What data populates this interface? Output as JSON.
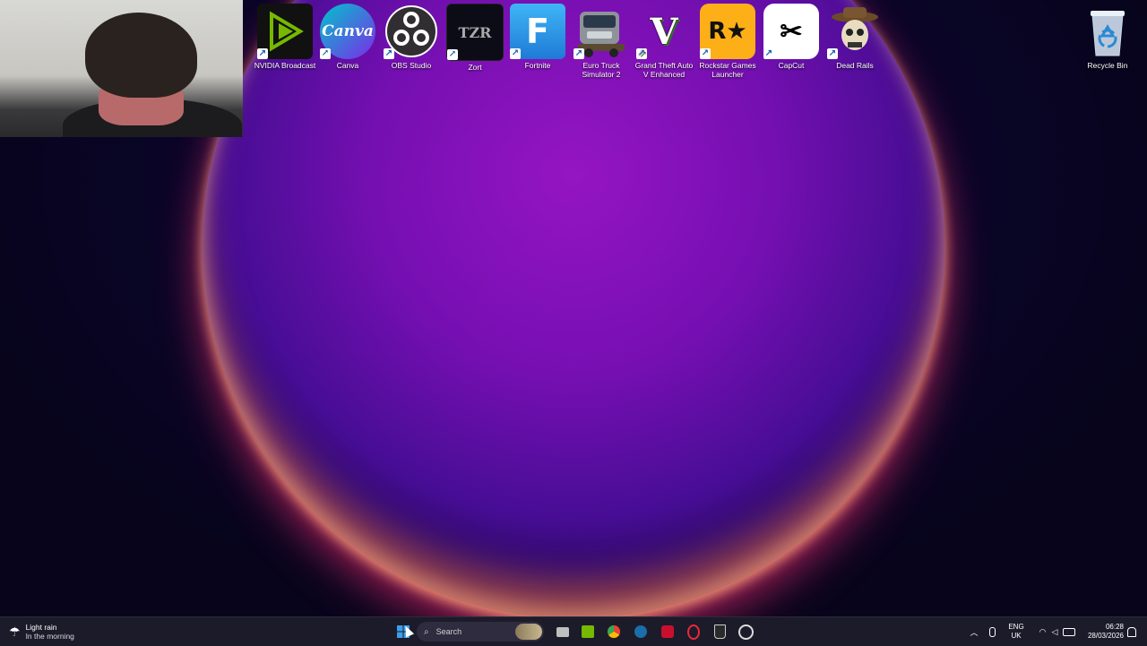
{
  "desktop": {
    "icons": [
      {
        "label": "NVIDIA Broadcast",
        "icon": "nvidia-broadcast-icon"
      },
      {
        "label": "Canva",
        "icon": "canva-icon"
      },
      {
        "label": "OBS Studio",
        "icon": "obs-icon"
      },
      {
        "label": "Zort",
        "icon": "zort-icon"
      },
      {
        "label": "Fortnite",
        "icon": "fortnite-icon"
      },
      {
        "label": "Euro Truck Simulator 2",
        "icon": "truck-icon"
      },
      {
        "label": "Grand Theft Auto V Enhanced",
        "icon": "gta-icon"
      },
      {
        "label": "Rockstar Games Launcher",
        "icon": "rockstar-icon"
      },
      {
        "label": "CapCut",
        "icon": "capcut-icon"
      },
      {
        "label": "Dead Rails",
        "icon": "dead-rails-icon"
      },
      {
        "label": "Recycle Bin",
        "icon": "recycle-bin-icon"
      }
    ],
    "icon_glyphs": {
      "canva": "Canva",
      "zort": "TZR",
      "fortnite": "F",
      "gta": "V",
      "rockstar": "R★",
      "capcut": "✂"
    },
    "shortcut_glyph": "↗"
  },
  "taskbar": {
    "weather": {
      "title": "Light rain",
      "subtitle": "In the morning",
      "icon": "rain-cloud-icon"
    },
    "search_placeholder": "Search",
    "pinned": [
      "file-explorer-icon",
      "nvidia-icon",
      "chrome-icon",
      "steam-icon",
      "rockstar-tb-icon",
      "opera-gx-icon",
      "epic-games-icon",
      "app-icon"
    ],
    "tray": {
      "lang_primary": "ENG",
      "lang_secondary": "UK",
      "time": "06:28",
      "date": "28/03/2026"
    }
  },
  "colors": {
    "taskbar_bg": "#1c1b2a",
    "accent": "#0078d4"
  }
}
